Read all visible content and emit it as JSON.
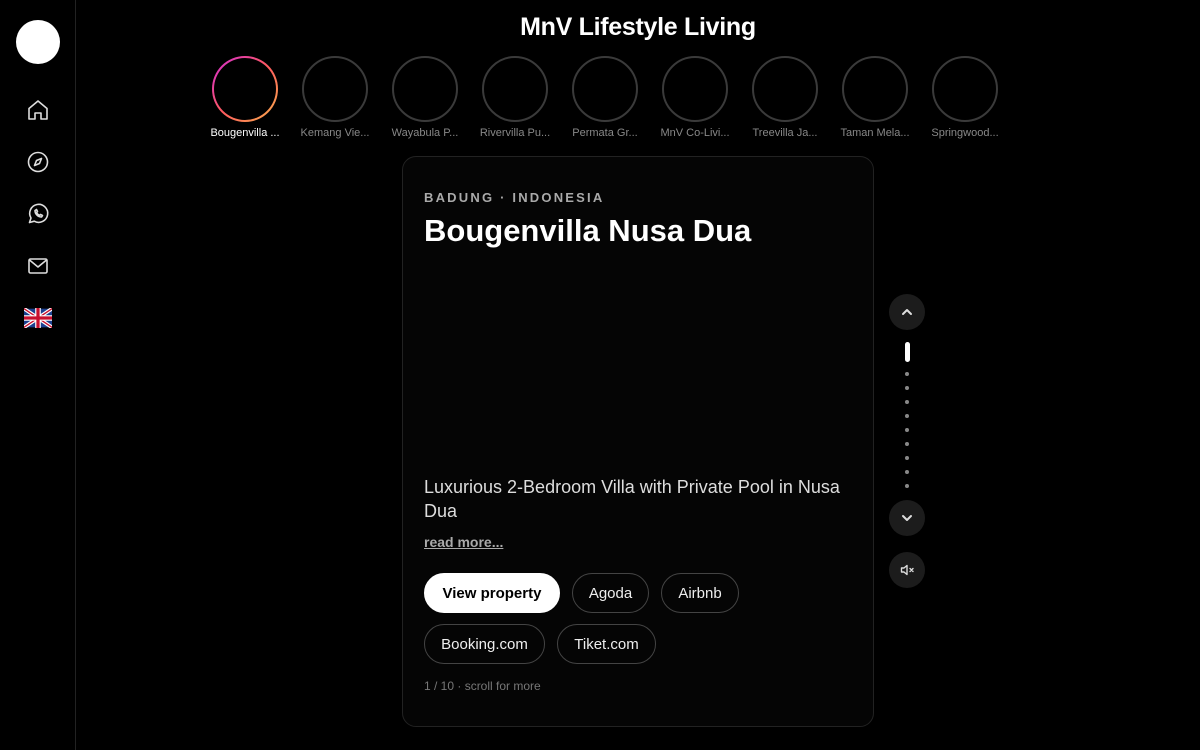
{
  "app": {
    "title": "MnV Lifestyle Living"
  },
  "sidebar": {
    "items": [
      {
        "icon": "home-icon"
      },
      {
        "icon": "compass-icon"
      },
      {
        "icon": "whatsapp-icon"
      },
      {
        "icon": "mail-icon"
      },
      {
        "icon": "uk-flag-icon"
      }
    ]
  },
  "stories": [
    {
      "label": "Bougenvilla ...",
      "active": true
    },
    {
      "label": "Kemang Vie..."
    },
    {
      "label": "Wayabula P..."
    },
    {
      "label": "Rivervilla Pu..."
    },
    {
      "label": "Permata Gr..."
    },
    {
      "label": "MnV Co-Livi..."
    },
    {
      "label": "Treevilla Ja..."
    },
    {
      "label": "Taman Mela..."
    },
    {
      "label": "Springwood..."
    }
  ],
  "property": {
    "location": "BADUNG · INDONESIA",
    "name": "Bougenvilla Nusa Dua",
    "description": "Luxurious 2-Bedroom Villa with Private Pool in Nusa Dua",
    "read_more": "read more...",
    "buttons": {
      "view": "View property",
      "agoda": "Agoda",
      "airbnb": "Airbnb",
      "booking": "Booking.com",
      "tiket": "Tiket.com"
    },
    "counter": "1 / 10 · scroll for more"
  },
  "pager": {
    "total": 10,
    "current": 1
  }
}
